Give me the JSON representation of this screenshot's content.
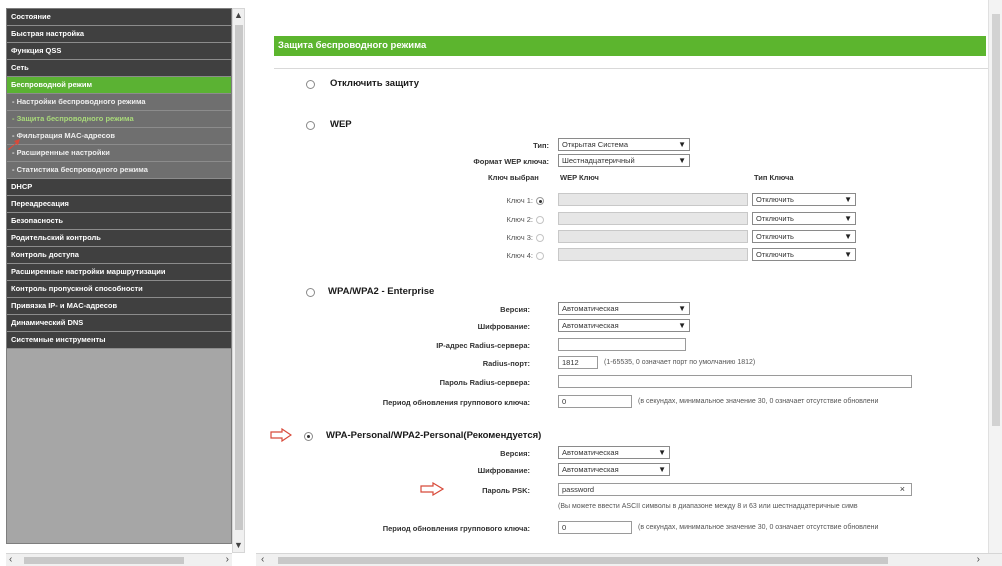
{
  "sidebar": {
    "items": [
      {
        "label": "Состояние"
      },
      {
        "label": "Быстрая настройка"
      },
      {
        "label": "Функция QSS"
      },
      {
        "label": "Сеть"
      },
      {
        "label": "Беспроводной режим"
      },
      {
        "label": "- Настройки беспроводного режима"
      },
      {
        "label": "- Защита беспроводного режима"
      },
      {
        "label": "- Фильтрация MAC-адресов"
      },
      {
        "label": "- Расширенные настройки"
      },
      {
        "label": "- Статистика беспроводного режима"
      },
      {
        "label": "DHCP"
      },
      {
        "label": "Переадресация"
      },
      {
        "label": "Безопасность"
      },
      {
        "label": "Родительский контроль"
      },
      {
        "label": "Контроль доступа"
      },
      {
        "label": "Расширенные настройки маршрутизации"
      },
      {
        "label": "Контроль пропускной способности"
      },
      {
        "label": "Привязка IP- и MAC-адресов"
      },
      {
        "label": "Динамический DNS"
      },
      {
        "label": "Системные инструменты"
      }
    ]
  },
  "page": {
    "title": "Защита беспроводного режима"
  },
  "disable": {
    "label": "Отключить защиту"
  },
  "wep": {
    "label": "WEP",
    "type_label": "Тип:",
    "type_value": "Открытая Система",
    "format_label": "Формат WEP ключа:",
    "format_value": "Шестнадцатеричный",
    "col_selected": "Ключ выбран",
    "col_key": "WEP Ключ",
    "col_type": "Тип Ключа",
    "keys": [
      {
        "label": "Ключ 1:",
        "type": "Отключить"
      },
      {
        "label": "Ключ 2:",
        "type": "Отключить"
      },
      {
        "label": "Ключ 3:",
        "type": "Отключить"
      },
      {
        "label": "Ключ 4:",
        "type": "Отключить"
      }
    ]
  },
  "enterprise": {
    "label": "WPA/WPA2 - Enterprise",
    "version_label": "Версия:",
    "version_value": "Автоматическая",
    "enc_label": "Шифрование:",
    "enc_value": "Автоматическая",
    "radius_ip_label": "IP-адрес Radius-сервера:",
    "radius_ip_value": "",
    "radius_port_label": "Radius-порт:",
    "radius_port_value": "1812",
    "radius_port_note": "(1-65535, 0 означает порт по умолчанию 1812)",
    "radius_pwd_label": "Пароль Radius-сервера:",
    "radius_pwd_value": "",
    "group_label": "Период обновления группового ключа:",
    "group_value": "0",
    "group_note": "(в секундах, минимальное значение 30, 0 означает отсутствие обновлени"
  },
  "personal": {
    "label": "WPA-Personal/WPA2-Personal(Рекомендуется)",
    "version_label": "Версия:",
    "version_value": "Автоматическая",
    "enc_label": "Шифрование:",
    "enc_value": "Автоматическая",
    "psk_label": "Пароль PSK:",
    "psk_value": "password",
    "psk_clear": "×",
    "psk_note": "(Вы можете ввести ASCII символы в диапазоне между 8 и 63 или шестнадцатеричные симв",
    "group_label": "Период обновления группового ключа:",
    "group_value": "0",
    "group_note": "(в секундах, минимальное значение 30, 0 означает отсутствие обновлени"
  },
  "colors": {
    "accent": "#5cb52e",
    "menu_bg": "#404040",
    "arrow": "#d84a3a"
  }
}
